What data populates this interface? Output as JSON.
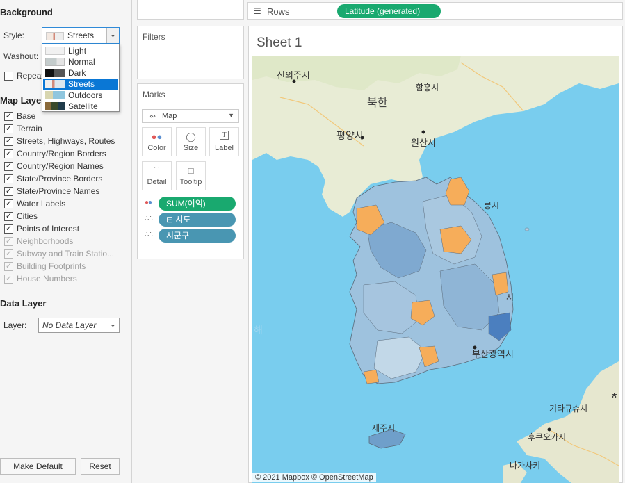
{
  "background": {
    "title": "Background",
    "style_label": "Style:",
    "style_value": "Streets",
    "washout_label": "Washout:",
    "repeat_label": "Repeat",
    "style_options": [
      {
        "label": "Light",
        "color": "#f2f2f2",
        "selected": false
      },
      {
        "label": "Normal",
        "color": "#d8dcdc",
        "selected": false
      },
      {
        "label": "Dark",
        "color": "#2b2b2b",
        "selected": false
      },
      {
        "label": "Streets",
        "color": "#d9b9b0",
        "selected": true
      },
      {
        "label": "Outdoors",
        "color": "#9ec9d8",
        "selected": false
      },
      {
        "label": "Satellite",
        "color": "#4a5a3c",
        "selected": false
      }
    ]
  },
  "map_layers": {
    "title": "Map Layers",
    "items": [
      {
        "label": "Base",
        "checked": true,
        "disabled": false
      },
      {
        "label": "Terrain",
        "checked": true,
        "disabled": false
      },
      {
        "label": "Streets, Highways, Routes",
        "checked": true,
        "disabled": false
      },
      {
        "label": "Country/Region Borders",
        "checked": true,
        "disabled": false
      },
      {
        "label": "Country/Region Names",
        "checked": true,
        "disabled": false
      },
      {
        "label": "State/Province Borders",
        "checked": true,
        "disabled": false
      },
      {
        "label": "State/Province Names",
        "checked": true,
        "disabled": false
      },
      {
        "label": "Water Labels",
        "checked": true,
        "disabled": false
      },
      {
        "label": "Cities",
        "checked": true,
        "disabled": false
      },
      {
        "label": "Points of Interest",
        "checked": true,
        "disabled": false
      },
      {
        "label": "Neighborhoods",
        "checked": true,
        "disabled": true
      },
      {
        "label": "Subway and Train Statio...",
        "checked": true,
        "disabled": true
      },
      {
        "label": "Building Footprints",
        "checked": true,
        "disabled": true
      },
      {
        "label": "House Numbers",
        "checked": true,
        "disabled": true
      }
    ]
  },
  "data_layer": {
    "title": "Data Layer",
    "layer_label": "Layer:",
    "layer_value": "No Data Layer"
  },
  "buttons": {
    "make_default": "Make Default",
    "reset": "Reset"
  },
  "filters": {
    "title": "Filters"
  },
  "marks": {
    "title": "Marks",
    "type": "Map",
    "buttons": {
      "color": "Color",
      "size": "Size",
      "label": "Label",
      "detail": "Detail",
      "tooltip": "Tooltip"
    },
    "pills": [
      {
        "text": "SUM(이익)",
        "kind": "green"
      },
      {
        "text": "⊟ 시도",
        "kind": "blue"
      },
      {
        "text": "시군구",
        "kind": "blue"
      }
    ]
  },
  "rows": {
    "label": "Rows",
    "pill": "Latitude (generated)"
  },
  "sheet": {
    "title": "Sheet 1",
    "attribution": "© 2021 Mapbox © OpenStreetMap",
    "map_labels": {
      "sinuiju": "신의주시",
      "hamheung": "함흥시",
      "bukhan": "북한",
      "pyongyang": "평양시",
      "wonsan": "원산시",
      "busan": "부산광역시",
      "jeju": "제주시",
      "kitakyushu": "기타큐슈시",
      "fukuoka": "후쿠오카시",
      "nagasaki": "나가사키",
      "daegu_partial": "시",
      "gangneung_partial": "릉시",
      "sea_partial": "해",
      "japan_partial": "ㅎ"
    }
  },
  "colors": {
    "sea": "#79cdee",
    "land": "#ecebd8",
    "north_land": "#e8ecd5",
    "region_blue": "#6f9fca",
    "region_light": "#b6d1e5",
    "region_orange": "#f6ad5a",
    "pill_green": "#19a96f",
    "pill_blue": "#4996b2"
  }
}
